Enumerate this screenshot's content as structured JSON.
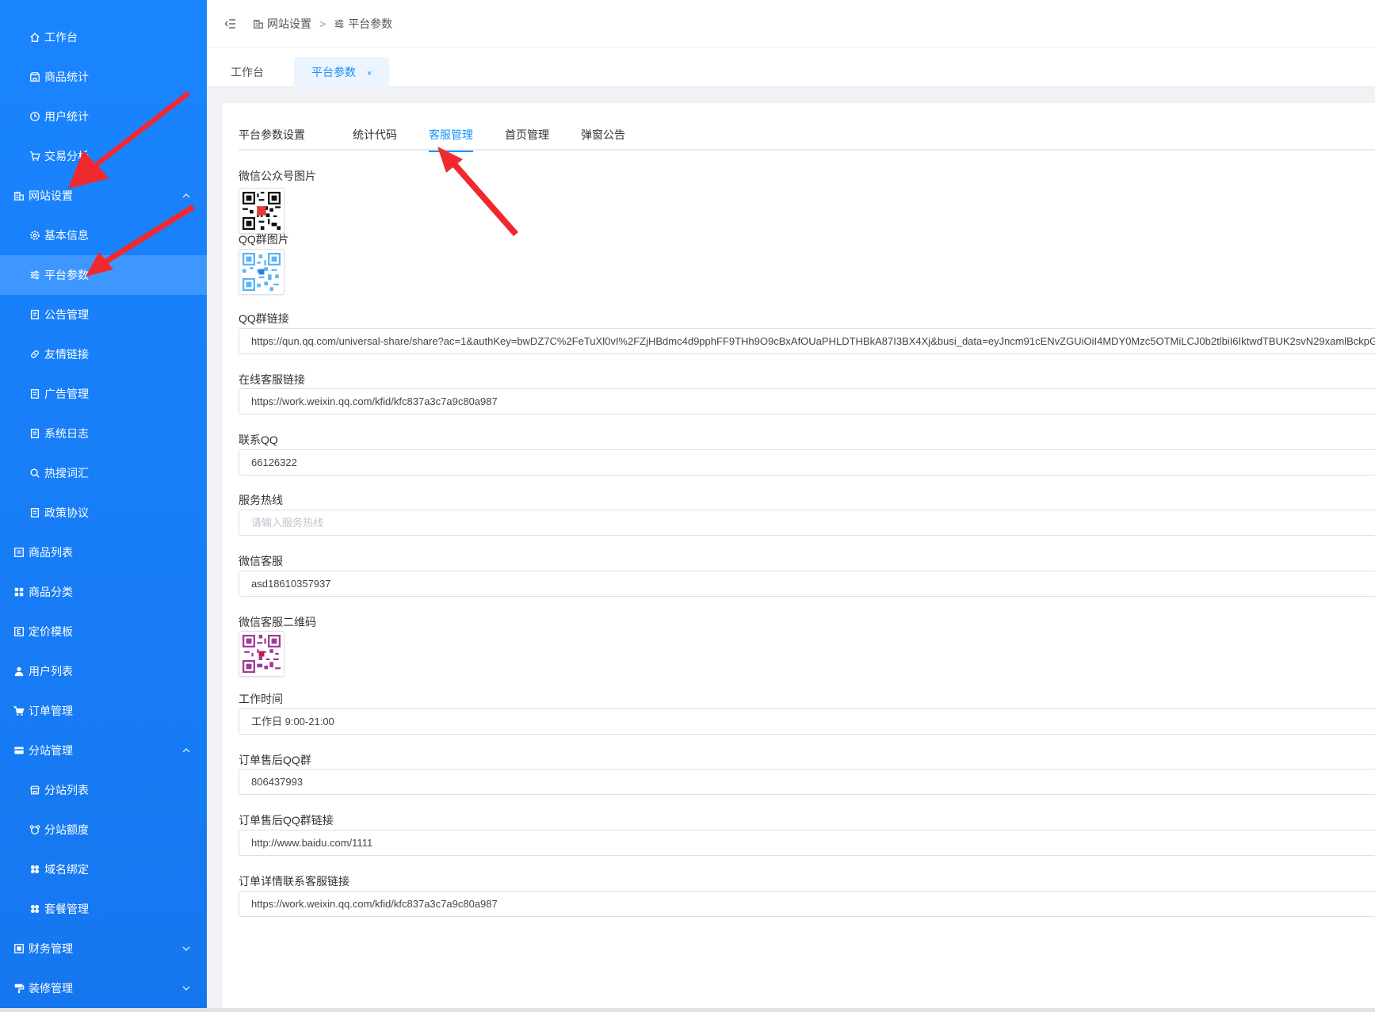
{
  "sidebar": {
    "items": [
      {
        "label": "工作台",
        "icon": "home-icon"
      },
      {
        "label": "商品统计",
        "icon": "shop-icon"
      },
      {
        "label": "用户统计",
        "icon": "clock-icon"
      },
      {
        "label": "交易分析",
        "icon": "cart-icon"
      },
      {
        "label": "网站设置",
        "icon": "building-icon"
      },
      {
        "label": "基本信息",
        "icon": "gear-icon"
      },
      {
        "label": "平台参数",
        "icon": "sliders-icon"
      },
      {
        "label": "公告管理",
        "icon": "doc-icon"
      },
      {
        "label": "友情链接",
        "icon": "link-icon"
      },
      {
        "label": "广告管理",
        "icon": "doc-icon"
      },
      {
        "label": "系统日志",
        "icon": "doc-icon"
      },
      {
        "label": "热搜词汇",
        "icon": "search-icon"
      },
      {
        "label": "政策协议",
        "icon": "doc-icon"
      },
      {
        "label": "商品列表",
        "icon": "list-icon"
      },
      {
        "label": "商品分类",
        "icon": "grid-icon"
      },
      {
        "label": "定价模板",
        "icon": "template-icon"
      },
      {
        "label": "用户列表",
        "icon": "user-icon"
      },
      {
        "label": "订单管理",
        "icon": "cart-icon"
      },
      {
        "label": "分站管理",
        "icon": "card-icon"
      },
      {
        "label": "分站列表",
        "icon": "store-icon"
      },
      {
        "label": "分站额度",
        "icon": "bear-icon"
      },
      {
        "label": "域名绑定",
        "icon": "clover-icon"
      },
      {
        "label": "套餐管理",
        "icon": "clover-icon"
      },
      {
        "label": "财务管理",
        "icon": "finance-icon"
      },
      {
        "label": "装修管理",
        "icon": "paint-icon"
      }
    ]
  },
  "breadcrumb": {
    "level1": "网站设置",
    "sep": ">",
    "level2": "平台参数"
  },
  "page_tabs": {
    "tab1": "工作台",
    "tab2": "平台参数",
    "close": "×"
  },
  "inner_tabs": [
    "平台参数设置",
    "统计代码",
    "客服管理",
    "首页管理",
    "弹窗公告"
  ],
  "form": {
    "wechat_img_label": "微信公众号图片",
    "qq_group_img_label": "QQ群图片",
    "qq_group_link_label": "QQ群链接",
    "qq_group_link_value": "https://qun.qq.com/universal-share/share?ac=1&authKey=bwDZ7C%2FeTuXl0vI%2FZjHBdmc4d9pphFF9THh9O9cBxAfOUaPHLDTHBkA87I3BX4Xj&busi_data=eyJncm91cENvZGUiOiI4MDY0Mzc5OTMiLCJ0b2tlbiI6IktwdTBUK2svN29xamlBckpG",
    "online_service_label": "在线客服链接",
    "online_service_value": "https://work.weixin.qq.com/kfid/kfc837a3c7a9c80a987",
    "contact_qq_label": "联系QQ",
    "contact_qq_value": "66126322",
    "hotline_label": "服务热线",
    "hotline_placeholder": "请输入服务热线",
    "wechat_service_label": "微信客服",
    "wechat_service_value": "asd18610357937",
    "wechat_qr_label": "微信客服二维码",
    "work_time_label": "工作时间",
    "work_time_value": "工作日 9:00-21:00",
    "aftersale_qq_label": "订单售后QQ群",
    "aftersale_qq_value": "806437993",
    "aftersale_link_label": "订单售后QQ群链接",
    "aftersale_link_value": "http://www.baidu.com/1111",
    "order_detail_label": "订单详情联系客服链接",
    "order_detail_value": "https://work.weixin.qq.com/kfid/kfc837a3c7a9c80a987"
  },
  "colors": {
    "sidebar": "#1a84ff",
    "accent": "#1890ff",
    "arrow": "#f0292f"
  }
}
